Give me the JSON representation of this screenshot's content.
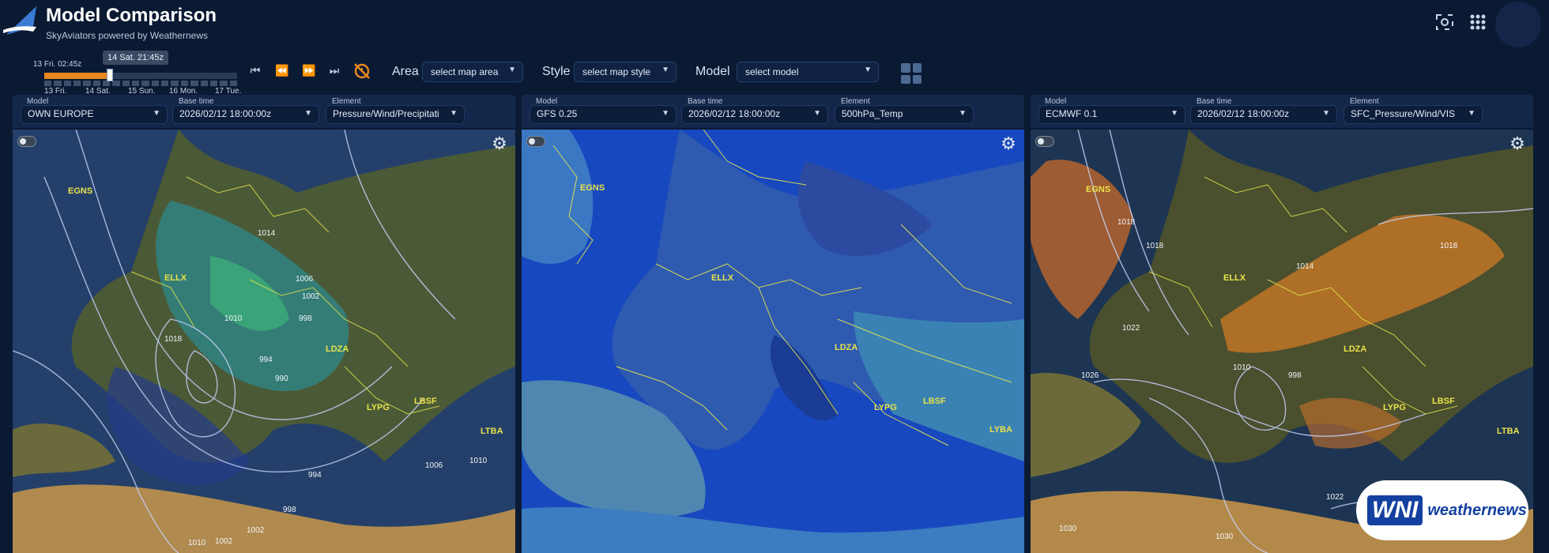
{
  "header": {
    "title": "Model Comparison",
    "subtitle": "SkyAviators powered by Weathernews",
    "icons": [
      "screenshot-icon",
      "apps-grid-icon",
      "avatar"
    ]
  },
  "timeline": {
    "start_label": "13 Fri. 02:45z",
    "current_label": "14 Sat. 21:45z",
    "day_labels": [
      "13 Fri.",
      "14 Sat.",
      "15 Sun.",
      "16 Mon.",
      "17 Tue."
    ],
    "progress": 0.34
  },
  "toolbar": {
    "area_label": "Area",
    "area_placeholder": "select map area",
    "style_label": "Style",
    "style_placeholder": "select map style",
    "model_label": "Model",
    "model_placeholder": "select model"
  },
  "panels": [
    {
      "model_label": "Model",
      "model": "OWN EUROPE",
      "base_time_label": "Base time",
      "base_time": "2026/02/12 18:00:00z",
      "element_label": "Element",
      "element": "Pressure/Wind/Precipitati",
      "airports": [
        "EGNS",
        "ELLX",
        "LDZA",
        "LYPG",
        "LBSF",
        "LTBA"
      ],
      "isobars": [
        "1014",
        "1006",
        "1002",
        "1010",
        "998",
        "994",
        "990",
        "1018",
        "994",
        "998",
        "1010",
        "1002",
        "1006",
        "1002",
        "1010",
        "1006"
      ]
    },
    {
      "model_label": "Model",
      "model": "GFS 0.25",
      "base_time_label": "Base time",
      "base_time": "2026/02/12 18:00:00z",
      "element_label": "Element",
      "element": "500hPa_Temp",
      "airports": [
        "EGNS",
        "ELLX",
        "LDZA",
        "LYPG",
        "LBSF",
        "LYBA"
      ],
      "isobars": []
    },
    {
      "model_label": "Model",
      "model": "ECMWF 0.1",
      "base_time_label": "Base time",
      "base_time": "2026/02/12 18:00:00z",
      "element_label": "Element",
      "element": "SFC_Pressure/Wind/VIS",
      "airports": [
        "EGNS",
        "ELLX",
        "LDZA",
        "LYPG",
        "LBSF",
        "LTBA"
      ],
      "isobars": [
        "1018",
        "1018",
        "1014",
        "1022",
        "1010",
        "1026",
        "998",
        "1018",
        "1022",
        "1030",
        "1030"
      ]
    }
  ],
  "branding": {
    "mark": "WNI",
    "text": "weathernews"
  },
  "colors": {
    "background": "#0b1a33",
    "accent": "#e8871e",
    "airport_label": "#e8e24a"
  }
}
